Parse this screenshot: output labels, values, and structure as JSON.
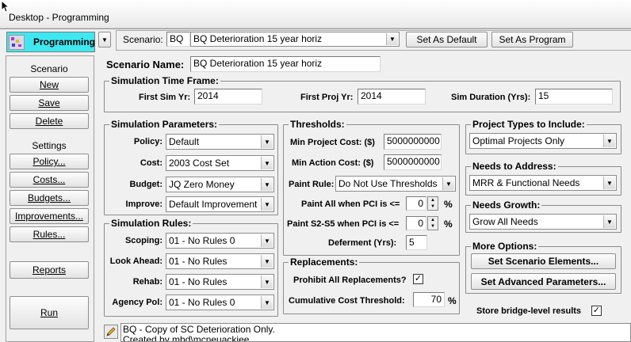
{
  "window": {
    "title": "Desktop - Programming"
  },
  "module": {
    "label": "Programming"
  },
  "scenario_bar": {
    "label": "Scenario:",
    "code": "BQ",
    "name": "BQ Deterioration 15 year horiz",
    "set_default": "Set As Default",
    "set_program": "Set As Program"
  },
  "sidebar": {
    "scenario_header": "Scenario",
    "new": "New",
    "save": "Save",
    "delete": "Delete",
    "settings_header": "Settings",
    "policy": "Policy...",
    "costs": "Costs...",
    "budgets": "Budgets...",
    "improvements": "Improvements...",
    "rules": "Rules...",
    "reports": "Reports",
    "run": "Run"
  },
  "scenario_name": {
    "label": "Scenario Name:",
    "value": "BQ Deterioration 15 year horiz"
  },
  "time_frame": {
    "legend": "Simulation Time Frame:",
    "first_sim_label": "First Sim Yr:",
    "first_sim": "2014",
    "first_proj_label": "First Proj Yr:",
    "first_proj": "2014",
    "duration_label": "Sim Duration (Yrs):",
    "duration": "15"
  },
  "params": {
    "legend": "Simulation Parameters:",
    "policy_label": "Policy:",
    "policy": "Default",
    "cost_label": "Cost:",
    "cost": "2003 Cost Set",
    "budget_label": "Budget:",
    "budget": "JQ Zero Money",
    "improve_label": "Improve:",
    "improve": "Default Improvement"
  },
  "rules": {
    "legend": "Simulation Rules:",
    "scoping_label": "Scoping:",
    "scoping": "01 - No Rules 0",
    "lookahead_label": "Look Ahead:",
    "lookahead": "01 - No Rules",
    "rehab_label": "Rehab:",
    "rehab": "01 - No Rules",
    "agency_label": "Agency Pol:",
    "agency": "01 - No Rules 0"
  },
  "thresholds": {
    "legend": "Thresholds:",
    "min_project_label": "Min Project Cost: ($)",
    "min_project": "5000000000",
    "min_action_label": "Min Action Cost: ($)",
    "min_action": "5000000000",
    "paint_rule_label": "Paint Rule:",
    "paint_rule": "Do Not Use Thresholds",
    "paint_all_label": "Paint All when PCI is <=",
    "paint_all": "0",
    "paint_s2_label": "Paint S2-S5 when PCI is <=",
    "paint_s2": "0",
    "percent": "%",
    "deferment_label": "Deferment (Yrs):",
    "deferment": "5"
  },
  "replacements": {
    "legend": "Replacements:",
    "prohibit_label": "Prohibit All Replacements?",
    "prohibit_checked": true,
    "cumulative_label": "Cumulative Cost Threshold:",
    "cumulative": "70",
    "percent": "%"
  },
  "project_types": {
    "legend": "Project Types to Include:",
    "value": "Optimal Projects Only"
  },
  "needs_address": {
    "legend": "Needs to Address:",
    "value": "MRR & Functional Needs"
  },
  "needs_growth": {
    "legend": "Needs Growth:",
    "value": "Grow All Needs"
  },
  "more_options": {
    "legend": "More Options:",
    "elements": "Set Scenario Elements...",
    "advanced": "Set Advanced Parameters..."
  },
  "store_bridge": {
    "label": "Store bridge-level results",
    "checked": true
  },
  "notes": {
    "line1": "BQ - Copy of SC Deterioration Only.",
    "line2": "Created by mbd\\mcneuackiee"
  }
}
